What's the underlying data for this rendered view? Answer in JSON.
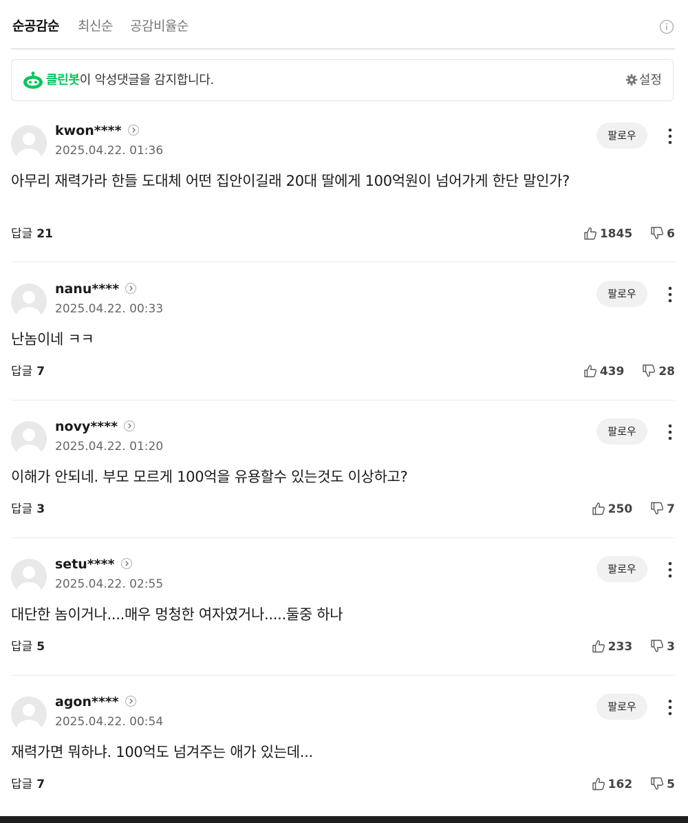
{
  "sort": {
    "tabs": [
      "순공감순",
      "최신순",
      "공감비율순"
    ],
    "active": 0
  },
  "cleanbot": {
    "brand": "클린봇",
    "message": "이 악성댓글을 감지합니다.",
    "settings_label": "설정",
    "brand_color": "#03c75a"
  },
  "labels": {
    "follow": "팔로우",
    "reply": "답글"
  },
  "comments": [
    {
      "author": "kwon****",
      "date": "2025.04.22. 01:36",
      "text": "아무리 재력가라 한들 도대체 어떤 집안이길래 20대 딸에게 100억원이 넘어가게 한단 말인가?",
      "replies": "21",
      "likes": "1845",
      "dislikes": "6"
    },
    {
      "author": "nanu****",
      "date": "2025.04.22. 00:33",
      "text": "난놈이네 ㅋㅋ",
      "replies": "7",
      "likes": "439",
      "dislikes": "28"
    },
    {
      "author": "novy****",
      "date": "2025.04.22. 01:20",
      "text": "이해가 안되네. 부모 모르게 100억을 유용할수 있는것도 이상하고?",
      "replies": "3",
      "likes": "250",
      "dislikes": "7"
    },
    {
      "author": "setu****",
      "date": "2025.04.22. 02:55",
      "text": "대단한 놈이거나....매우 멍청한 여자였거나.....둘중 하나",
      "replies": "5",
      "likes": "233",
      "dislikes": "3"
    },
    {
      "author": "agon****",
      "date": "2025.04.22. 00:54",
      "text": "재력가면 뭐하냐. 100억도 넘겨주는 애가 있는데...",
      "replies": "7",
      "likes": "162",
      "dislikes": "5"
    }
  ],
  "icons": {
    "info": "info-icon",
    "bot": "cleanbot-icon",
    "settings": "gear-icon",
    "avatar": "default-avatar-icon",
    "author_more": "chevron-right-icon",
    "more": "more-vertical-icon",
    "like": "thumbs-up-icon",
    "dislike": "thumbs-down-icon"
  }
}
